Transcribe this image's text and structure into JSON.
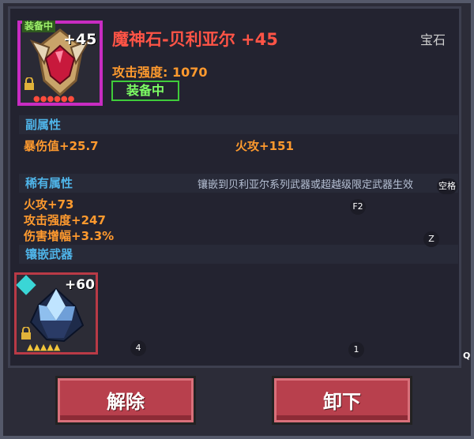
{
  "item": {
    "equipped_badge": "装备中",
    "plus_level": "+45",
    "name": "魔神石-贝利亚尔 +45",
    "type": "宝石",
    "attack_label": "攻击强度: 1070",
    "equipped_button": "装备中",
    "stars": "●●●●●●",
    "rarity_color": "#c82cc2"
  },
  "sections": {
    "secondary": {
      "title": "副属性",
      "stats": [
        "暴伤值+25.7",
        "火攻+151"
      ]
    },
    "rare": {
      "title": "稀有属性",
      "note": "镶嵌到贝利亚尔系列武器或超越级限定武器生效",
      "stats": [
        "火攻+73",
        "攻击强度+247",
        "伤害增幅+3.3%"
      ]
    },
    "socket": {
      "title": "镶嵌武器",
      "weapon_plus": "+60",
      "weapon_stars": "▲▲▲▲▲"
    }
  },
  "hotkeys": {
    "space": "空格",
    "f2": "F2",
    "z": "Z",
    "four": "4",
    "one": "1",
    "q": "Q"
  },
  "buttons": {
    "remove": "解除",
    "unequip": "卸下"
  }
}
